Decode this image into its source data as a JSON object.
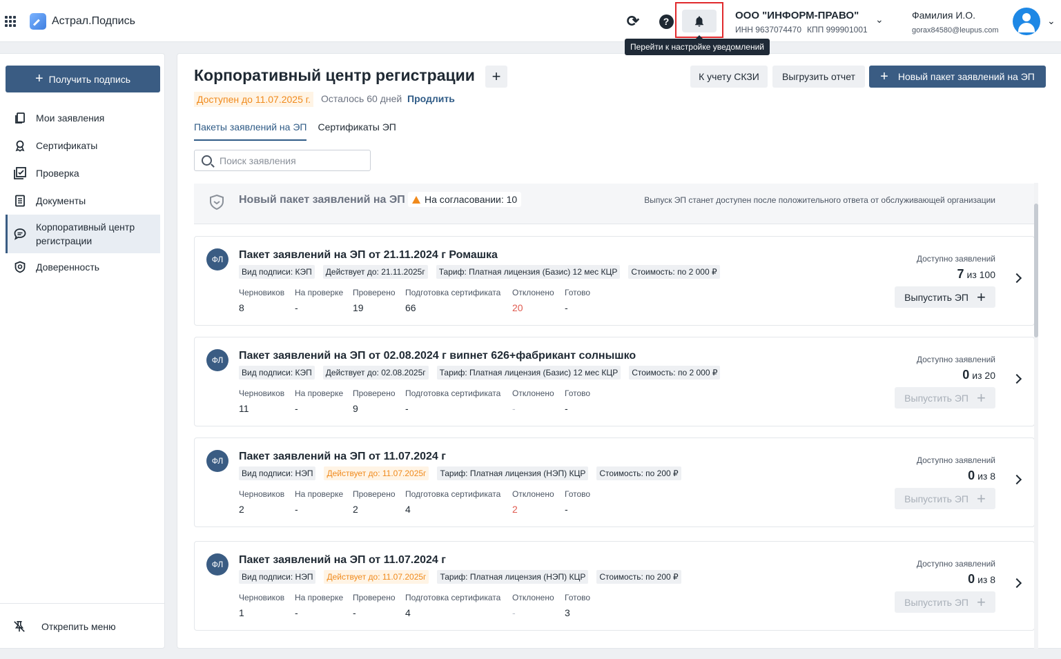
{
  "header": {
    "logo_text": "Астрал.Подпись",
    "tooltip": "Перейти к настройке уведомлений",
    "org_name": "ООО \"ИНФОРМ-ПРАВО\"",
    "org_inn": "ИНН 9637074470",
    "org_kpp": "КПП 999901001",
    "user_name": "Фамилия И.О.",
    "user_email": "gorax84580@leupus.com",
    "icons": [
      "apps-grid-icon",
      "refresh-icon",
      "help-icon",
      "bell-icon",
      "chevron-down-icon",
      "avatar-icon"
    ],
    "highlight_color": "#e0292c"
  },
  "sidebar": {
    "get_sign_label": "Получить подпись",
    "items": [
      {
        "label": "Мои заявления",
        "icon": "documents-icon"
      },
      {
        "label": "Сертификаты",
        "icon": "award-icon"
      },
      {
        "label": "Проверка",
        "icon": "checkbox-icon"
      },
      {
        "label": "Документы",
        "icon": "document-icon"
      },
      {
        "label": "Корпоративный центр регистрации",
        "icon": "chat-icon",
        "active": true
      },
      {
        "label": "Доверенность",
        "icon": "shield-icon"
      }
    ],
    "unpin_label": "Открепить меню"
  },
  "main": {
    "title": "Корпоративный центр регистрации",
    "available_until": "Доступен до 11.07.2025 г.",
    "days_left": "Осталось 60 дней",
    "extend_label": "Продлить",
    "btn_skzi": "К учету СКЗИ",
    "btn_report": "Выгрузить отчет",
    "btn_new": "Новый пакет заявлений на ЭП",
    "tabs": [
      {
        "label": "Пакеты заявлений на ЭП",
        "active": true
      },
      {
        "label": "Сертификаты ЭП",
        "active": false
      }
    ],
    "search_placeholder": "Поиск заявления",
    "new_pack": {
      "title": "Новый пакет заявлений на ЭП",
      "badge": "На согласовании: 10",
      "note": "Выпуск ЭП станет доступен после положительного ответа от обслуживающей организации"
    },
    "stat_labels": [
      "Черновиков",
      "На проверке",
      "Проверено",
      "Подготовка сертификата",
      "Отклонено",
      "Готово"
    ],
    "avail_label": "Доступно заявлений",
    "issue_label": "Выпустить ЭП",
    "badge_text": "ФЛ",
    "packs": [
      {
        "title": "Пакет заявлений на ЭП от 21.11.2024 г Ромашка",
        "tags": [
          "Вид подписи: КЭП",
          "Действует до: 21.11.2025г",
          "Тариф: Платная лицензия (Базис) 12 мес КЦР",
          "Стоимость: по 2 000 ₽"
        ],
        "stats": [
          "8",
          "-",
          "19",
          "66",
          "20",
          "-"
        ],
        "rejected_style": "red",
        "avail": "7",
        "avail_total": "из 100",
        "issue_enabled": true
      },
      {
        "title": "Пакет заявлений на ЭП от 02.08.2024 г випнет 626+фабрикант солнышко",
        "tags": [
          "Вид подписи: КЭП",
          "Действует до: 02.08.2025г",
          "Тариф: Платная лицензия (Базис) 12 мес КЦР",
          "Стоимость: по 2 000 ₽"
        ],
        "stats": [
          "11",
          "-",
          "9",
          "-",
          "-",
          "-"
        ],
        "rejected_style": "muted",
        "avail": "0",
        "avail_total": "из 20",
        "issue_enabled": false
      },
      {
        "title": "Пакет заявлений на ЭП от 11.07.2024 г",
        "tags": [
          "Вид подписи: НЭП",
          "Действует до: 11.07.2025г",
          "Тариф: Платная лицензия (НЭП) КЦР",
          "Стоимость: по 200 ₽"
        ],
        "stats": [
          "2",
          "-",
          "2",
          "4",
          "2",
          "-"
        ],
        "rejected_style": "red",
        "warn_tag": true,
        "avail": "0",
        "avail_total": "из 8",
        "issue_enabled": false
      },
      {
        "title": "Пакет заявлений на ЭП от 11.07.2024 г",
        "tags": [
          "Вид подписи: НЭП",
          "Действует до: 11.07.2025г",
          "Тариф: Платная лицензия (НЭП) КЦР",
          "Стоимость: по 200 ₽"
        ],
        "stats": [
          "1",
          "-",
          "-",
          "4",
          "-",
          "3"
        ],
        "rejected_style": "muted",
        "warn_tag": true,
        "avail": "0",
        "avail_total": "из 8",
        "issue_enabled": false
      }
    ]
  }
}
